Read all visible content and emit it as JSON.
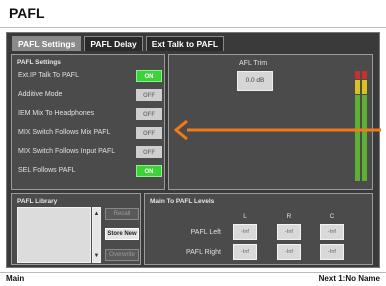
{
  "title": "PAFL",
  "tabs": [
    {
      "label": "PAFL Settings",
      "active": true
    },
    {
      "label": "PAFL Delay",
      "active": false
    },
    {
      "label": "Ext Talk to PAFL",
      "active": false
    }
  ],
  "settings": {
    "title": "PAFL Settings",
    "rows": [
      {
        "label": "Ext.IP Talk To PAFL",
        "state": "ON"
      },
      {
        "label": "Additive Mode",
        "state": "OFF"
      },
      {
        "label": "IEM Mix To Headphones",
        "state": "OFF"
      },
      {
        "label": "MIX Switch Follows Mix PAFL",
        "state": "OFF"
      },
      {
        "label": "MIX Switch Follows Input PAFL",
        "state": "OFF"
      },
      {
        "label": "SEL Follows PAFL",
        "state": "ON"
      }
    ]
  },
  "trim": {
    "label": "AFL Trim",
    "value": "0.0 dB"
  },
  "library": {
    "title": "PAFL Library",
    "recall": "Recall",
    "store_new": "Store New",
    "overwrite": "Overwrite"
  },
  "levels": {
    "title": "Main To PAFL Levels",
    "columns": [
      "L",
      "R",
      "C"
    ],
    "rows": [
      {
        "label": "PAFL Left",
        "values": [
          "-Inf",
          "-Inf",
          "-Inf"
        ]
      },
      {
        "label": "PAFL Right",
        "values": [
          "-Inf",
          "-Inf",
          "-Inf"
        ]
      }
    ]
  },
  "status": {
    "left": "Main",
    "right": "Next 1:No Name"
  },
  "colors": {
    "on": "#3dd13a",
    "arrow": "#f07a1a",
    "meter_red": "#c9302c",
    "meter_yellow": "#d8c31e",
    "meter_green": "#5db033"
  }
}
